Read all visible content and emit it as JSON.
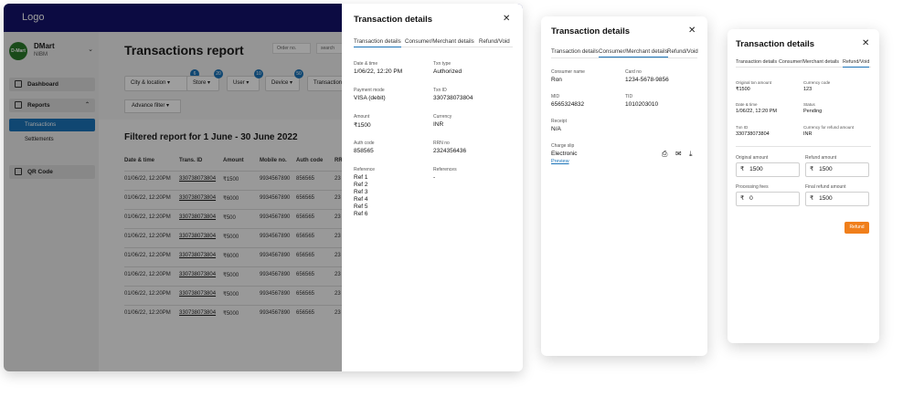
{
  "app": {
    "logo": "Logo",
    "store": {
      "avatar_text": "D-Mart",
      "name": "DMart",
      "sub": "NIBM"
    },
    "nav": [
      {
        "label": "Dashboard",
        "icon": "dashboard-icon"
      },
      {
        "label": "Reports",
        "icon": "reports-icon"
      },
      {
        "label": "QR Code",
        "icon": "qr-code-icon"
      }
    ],
    "subnav": [
      "Transactions",
      "Settlements"
    ],
    "page_title": "Transactions report",
    "order_placeholder": "Order no.",
    "search_placeholder": "search",
    "filters": [
      {
        "label": "City & location",
        "badge": "6"
      },
      {
        "label": "Store",
        "badge": "20"
      },
      {
        "label": "User",
        "badge": "10"
      },
      {
        "label": "Device",
        "badge": "50"
      },
      {
        "label": "Transaction s",
        "badge": ""
      }
    ],
    "advance_filter": "Advance filter",
    "filtered_title": "Filtered report for 1 June - 30 June 2022",
    "table": {
      "columns": [
        "Date & time",
        "Trans. ID",
        "Amount",
        "Mobile no.",
        "Auth code",
        "RR"
      ],
      "rows": [
        [
          "01/06/22, 12:20PM",
          "330738073804",
          "₹1500",
          "9934567890",
          "856565",
          "23"
        ],
        [
          "01/06/22, 12:20PM",
          "330738073804",
          "₹6000",
          "9934567890",
          "656565",
          "23"
        ],
        [
          "01/06/22, 12:20PM",
          "330738073804",
          "₹500",
          "9934567890",
          "656565",
          "23"
        ],
        [
          "01/06/22, 12:20PM",
          "330738073804",
          "₹5000",
          "9934567890",
          "656565",
          "23"
        ],
        [
          "01/06/22, 12:20PM",
          "330738073804",
          "₹6000",
          "9934567890",
          "656565",
          "23"
        ],
        [
          "01/06/22, 12:20PM",
          "330738073804",
          "₹5000",
          "9934567890",
          "656565",
          "23"
        ],
        [
          "01/06/22, 12:20PM",
          "330738073804",
          "₹5000",
          "9934567890",
          "656565",
          "23"
        ],
        [
          "01/06/22, 12:20PM",
          "330738073804",
          "₹5000",
          "9934567890",
          "656565",
          "23"
        ]
      ]
    }
  },
  "drawer1": {
    "title": "Transaction details",
    "tabs": [
      "Transaction details",
      "Consumer/Merchant details",
      "Refund/Void"
    ],
    "fields": [
      {
        "label": "Date & time",
        "value": "1/06/22, 12:20 PM"
      },
      {
        "label": "Txn type",
        "value": "Authorized"
      },
      {
        "label": "Payment mode",
        "value": "VISA (debit)"
      },
      {
        "label": "Txn ID",
        "value": "330738073804"
      },
      {
        "label": "Amount",
        "value": "₹1500"
      },
      {
        "label": "Currency",
        "value": "INR"
      },
      {
        "label": "Auth code",
        "value": "858565"
      },
      {
        "label": "RRN no",
        "value": "2324356436"
      }
    ],
    "reference_label": "Reference",
    "references": [
      "Ref 1",
      "Ref 2",
      "Ref 3",
      "Ref 4",
      "Ref 5",
      "Ref 6"
    ],
    "references_label": "References",
    "references_value": "-"
  },
  "drawer2": {
    "title": "Transaction details",
    "tabs": [
      "Transaction details",
      "Consumer/Merchant details",
      "Refund/Void"
    ],
    "fields": [
      {
        "label": "Consumer name",
        "value": "Ron"
      },
      {
        "label": "Card no",
        "value": "1234-5678-9856"
      },
      {
        "label": "MID",
        "value": "6565324832"
      },
      {
        "label": "TID",
        "value": "1010203010"
      },
      {
        "label": "Receipt",
        "value": "N/A"
      }
    ],
    "charge_slip_label": "Charge slip",
    "charge_slip_value": "Electronic",
    "preview": "Preview"
  },
  "drawer3": {
    "title": "Transaction details",
    "tabs": [
      "Transaction details",
      "Consumer/Merchant details",
      "Refund/Void"
    ],
    "fields": [
      {
        "label": "Original txn amount",
        "value": "₹1500"
      },
      {
        "label": "Currency code",
        "value": "123"
      },
      {
        "label": "Date & time",
        "value": "1/06/22, 12:20 PM"
      },
      {
        "label": "Status",
        "value": "Pending"
      },
      {
        "label": "Txn ID",
        "value": "330738073804"
      },
      {
        "label": "Currency for refund amount",
        "value": "INR"
      }
    ],
    "inputs": [
      {
        "label": "Original amount",
        "currency": "₹",
        "value": "1500"
      },
      {
        "label": "Refund amount",
        "currency": "₹",
        "value": "1500"
      },
      {
        "label": "Processing fees",
        "currency": "₹",
        "value": "0"
      },
      {
        "label": "Final refund amount",
        "currency": "₹",
        "value": "1500"
      }
    ],
    "refund_button": "Refund"
  }
}
